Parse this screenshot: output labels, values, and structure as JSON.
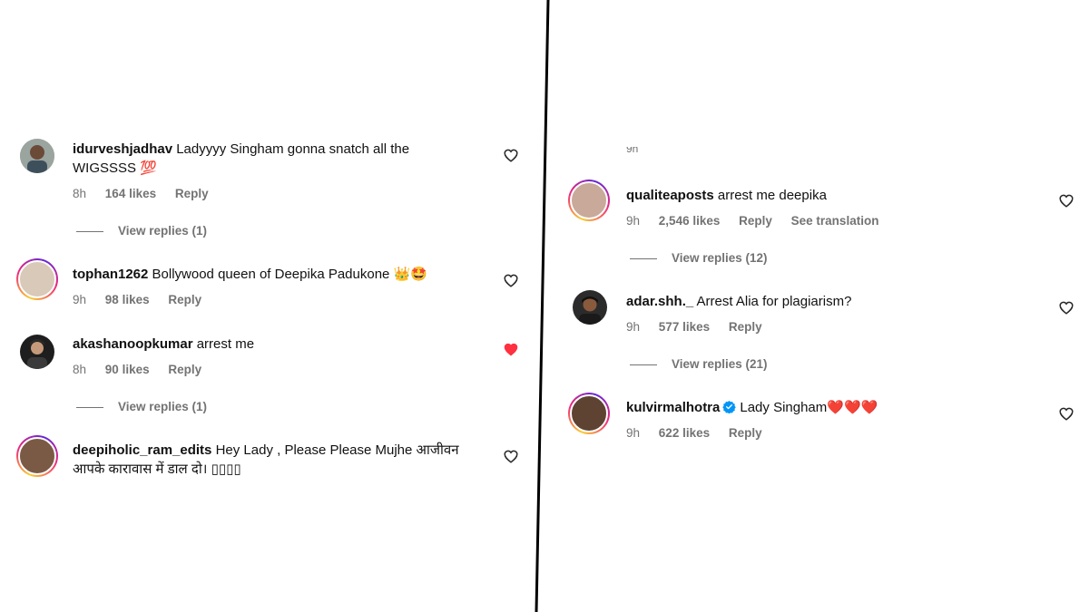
{
  "left_panel": {
    "comments": [
      {
        "username": "idurveshjadhav",
        "text": "Ladyyyy Singham gonna snatch all the WIGSSSS 💯",
        "time": "8h",
        "likes": "164 likes",
        "reply": "Reply",
        "view_replies": "View replies (1)",
        "liked": false
      },
      {
        "username": "tophan1262",
        "text": "Bollywood queen of Deepika Padukone 👑🤩",
        "time": "9h",
        "likes": "98 likes",
        "reply": "Reply",
        "liked": false
      },
      {
        "username": "akashanoopkumar",
        "text": "arrest me",
        "time": "8h",
        "likes": "90 likes",
        "reply": "Reply",
        "view_replies": "View replies (1)",
        "liked": true
      },
      {
        "username": "deepiholic_ram_edits",
        "text": "Hey Lady , Please Please Mujhe आजीवन आपके कारावास में डाल दो। ▯▯▯▯",
        "liked": false
      }
    ]
  },
  "right_panel": {
    "comments": [
      {
        "username": "qualiteaposts",
        "text": "arrest me deepika",
        "time": "9h",
        "likes": "2,546 likes",
        "reply": "Reply",
        "see_translation": "See translation",
        "view_replies": "View replies (12)",
        "liked": false
      },
      {
        "username": "adar.shh._",
        "text": "Arrest Alia for plagiarism?",
        "time": "9h",
        "likes": "577 likes",
        "reply": "Reply",
        "view_replies": "View replies (21)",
        "liked": false
      },
      {
        "username": "kulvirmalhotra",
        "text": "Lady Singham❤️❤️❤️",
        "time": "9h",
        "likes": "622 likes",
        "reply": "Reply",
        "verified": true,
        "liked": false
      }
    ]
  },
  "colors": {
    "text": "#111111",
    "meta": "#737373",
    "liked_heart": "#ff3040",
    "verified": "#0095f6"
  },
  "icons": {
    "like": "heart-outline-icon",
    "liked": "heart-filled-icon",
    "verified": "verified-badge-icon"
  }
}
